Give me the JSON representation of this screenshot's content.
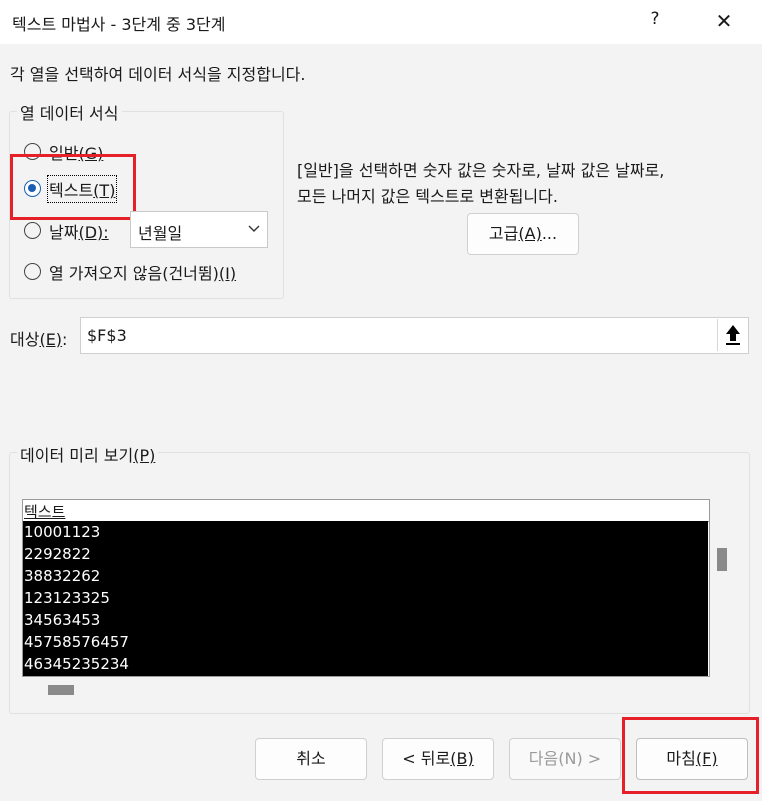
{
  "window": {
    "title": "텍스트 마법사 - 3단계 중 3단계",
    "help_label": "?",
    "close_label": "✕"
  },
  "instruction": "각 열을 선택하여 데이터 서식을 지정합니다.",
  "column_format": {
    "group_label": "열 데이터 서식",
    "options": [
      {
        "label": "일반",
        "mnemonic": "(G)",
        "checked": false
      },
      {
        "label": "텍스트",
        "mnemonic": "(T)",
        "checked": true
      },
      {
        "label": "날짜",
        "mnemonic": "(D):",
        "checked": false
      },
      {
        "label": "열 가져오지 않음(건너뜀)",
        "mnemonic": "(I)",
        "checked": false
      }
    ],
    "date_format": {
      "value": "년월일",
      "chevron_icon": "chevron-down"
    }
  },
  "description": {
    "line1": "[일반]을 선택하면 숫자 값은 숫자로, 날짜 값은 날짜로,",
    "line2": "모든 나머지 값은 텍스트로 변환됩니다."
  },
  "advanced_button": {
    "label": "고급",
    "mnemonic": "(A)",
    "ellipsis": "..."
  },
  "destination": {
    "label": "대상",
    "mnemonic": "(E)",
    "colon": ":",
    "value": "$F$3",
    "collapse_icon": "arrow-up"
  },
  "preview": {
    "group_label": "데이터 미리 보기",
    "mnemonic": "(P)",
    "column_header": "텍스트",
    "rows": [
      "10001123",
      "2292822",
      "38832262",
      "123123325",
      "34563453",
      "45758576457",
      "46345235234"
    ]
  },
  "buttons": {
    "cancel": "취소",
    "back_prefix": "< 뒤로",
    "back_mnemonic": "(B)",
    "next": "다음(N) >",
    "finish": "마침",
    "finish_mnemonic": "(F)"
  },
  "colors": {
    "highlight": "#e52028",
    "radio_accent": "#1a5fb4",
    "preview_background": "#000000"
  }
}
